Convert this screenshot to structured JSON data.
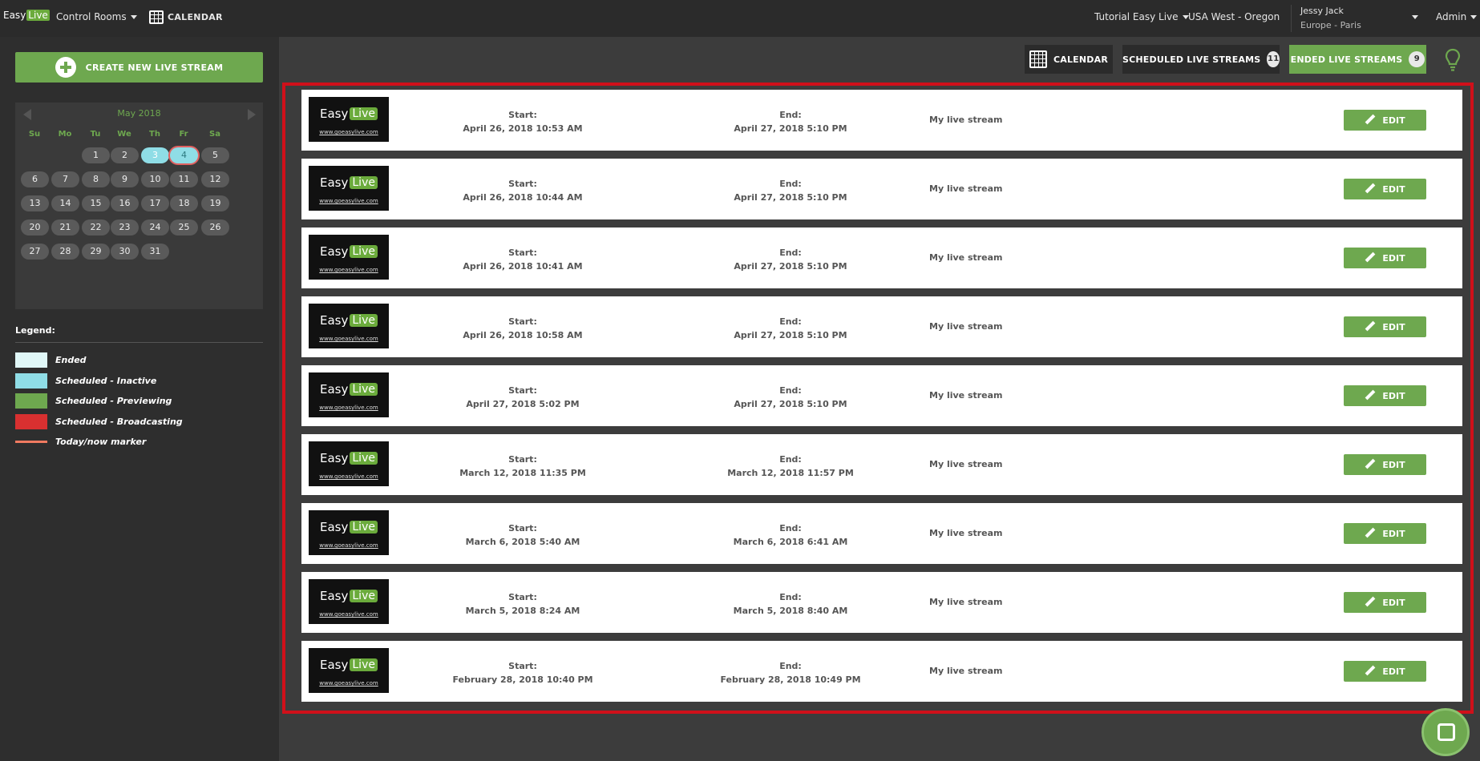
{
  "topbar": {
    "logo_easy": "Easy",
    "logo_live": "Live",
    "control_rooms": "Control Rooms",
    "calendar": "CALENDAR",
    "tutorial": "Tutorial Easy Live",
    "region": "USA West - Oregon",
    "user_name": "Jessy Jack",
    "user_tz": "Europe - Paris",
    "admin": "Admin"
  },
  "sidebar": {
    "create_label": "CREATE NEW LIVE STREAM",
    "calendar": {
      "month": "May 2018",
      "weekdays": [
        "Su",
        "Mo",
        "Tu",
        "We",
        "Th",
        "Fr",
        "Sa"
      ],
      "days": [
        "1",
        "2",
        "3",
        "4",
        "5",
        "6",
        "7",
        "8",
        "9",
        "10",
        "11",
        "12",
        "13",
        "14",
        "15",
        "16",
        "17",
        "18",
        "19",
        "20",
        "21",
        "22",
        "23",
        "24",
        "25",
        "26",
        "27",
        "28",
        "29",
        "30",
        "31"
      ],
      "scheduled_inactive_day": "3",
      "today_day": "4"
    },
    "legend": {
      "title": "Legend:",
      "items": [
        {
          "label": "Ended",
          "color": "#e0f7f7"
        },
        {
          "label": "Scheduled - Inactive",
          "color": "#8fdde6"
        },
        {
          "label": "Scheduled - Previewing",
          "color": "#6ea84f"
        },
        {
          "label": "Scheduled - Broadcasting",
          "color": "#d93030"
        },
        {
          "label": "Today/now marker",
          "color": "#f07a60"
        }
      ]
    }
  },
  "tabs": {
    "calendar": "CALENDAR",
    "scheduled": "SCHEDULED LIVE STREAMS",
    "scheduled_count": "11",
    "ended": "ENDED LIVE STREAMS",
    "ended_count": "9"
  },
  "streams": [
    {
      "start_label": "Start:",
      "start": "April 26, 2018 10:53 AM",
      "end_label": "End:",
      "end": "April 27, 2018 5:10 PM",
      "title": "My live stream",
      "edit": "EDIT"
    },
    {
      "start_label": "Start:",
      "start": "April 26, 2018 10:44 AM",
      "end_label": "End:",
      "end": "April 27, 2018 5:10 PM",
      "title": "My live stream",
      "edit": "EDIT"
    },
    {
      "start_label": "Start:",
      "start": "April 26, 2018 10:41 AM",
      "end_label": "End:",
      "end": "April 27, 2018 5:10 PM",
      "title": "My live stream",
      "edit": "EDIT"
    },
    {
      "start_label": "Start:",
      "start": "April 26, 2018 10:58 AM",
      "end_label": "End:",
      "end": "April 27, 2018 5:10 PM",
      "title": "My live stream",
      "edit": "EDIT"
    },
    {
      "start_label": "Start:",
      "start": "April 27, 2018 5:02 PM",
      "end_label": "End:",
      "end": "April 27, 2018 5:10 PM",
      "title": "My live stream",
      "edit": "EDIT"
    },
    {
      "start_label": "Start:",
      "start": "March 12, 2018 11:35 PM",
      "end_label": "End:",
      "end": "March 12, 2018 11:57 PM",
      "title": "My live stream",
      "edit": "EDIT"
    },
    {
      "start_label": "Start:",
      "start": "March 6, 2018 5:40 AM",
      "end_label": "End:",
      "end": "March 6, 2018 6:41 AM",
      "title": "My live stream",
      "edit": "EDIT"
    },
    {
      "start_label": "Start:",
      "start": "March 5, 2018 8:24 AM",
      "end_label": "End:",
      "end": "March 5, 2018 8:40 AM",
      "title": "My live stream",
      "edit": "EDIT"
    },
    {
      "start_label": "Start:",
      "start": "February 28, 2018 10:40 PM",
      "end_label": "End:",
      "end": "February 28, 2018 10:49 PM",
      "title": "My live stream",
      "edit": "EDIT"
    }
  ],
  "thumbnail": {
    "easy": "Easy",
    "live": "Live",
    "url": "www.goeasylive.com"
  },
  "colors": {
    "accent": "#6ea84f",
    "highlight_frame": "#d0101a"
  }
}
